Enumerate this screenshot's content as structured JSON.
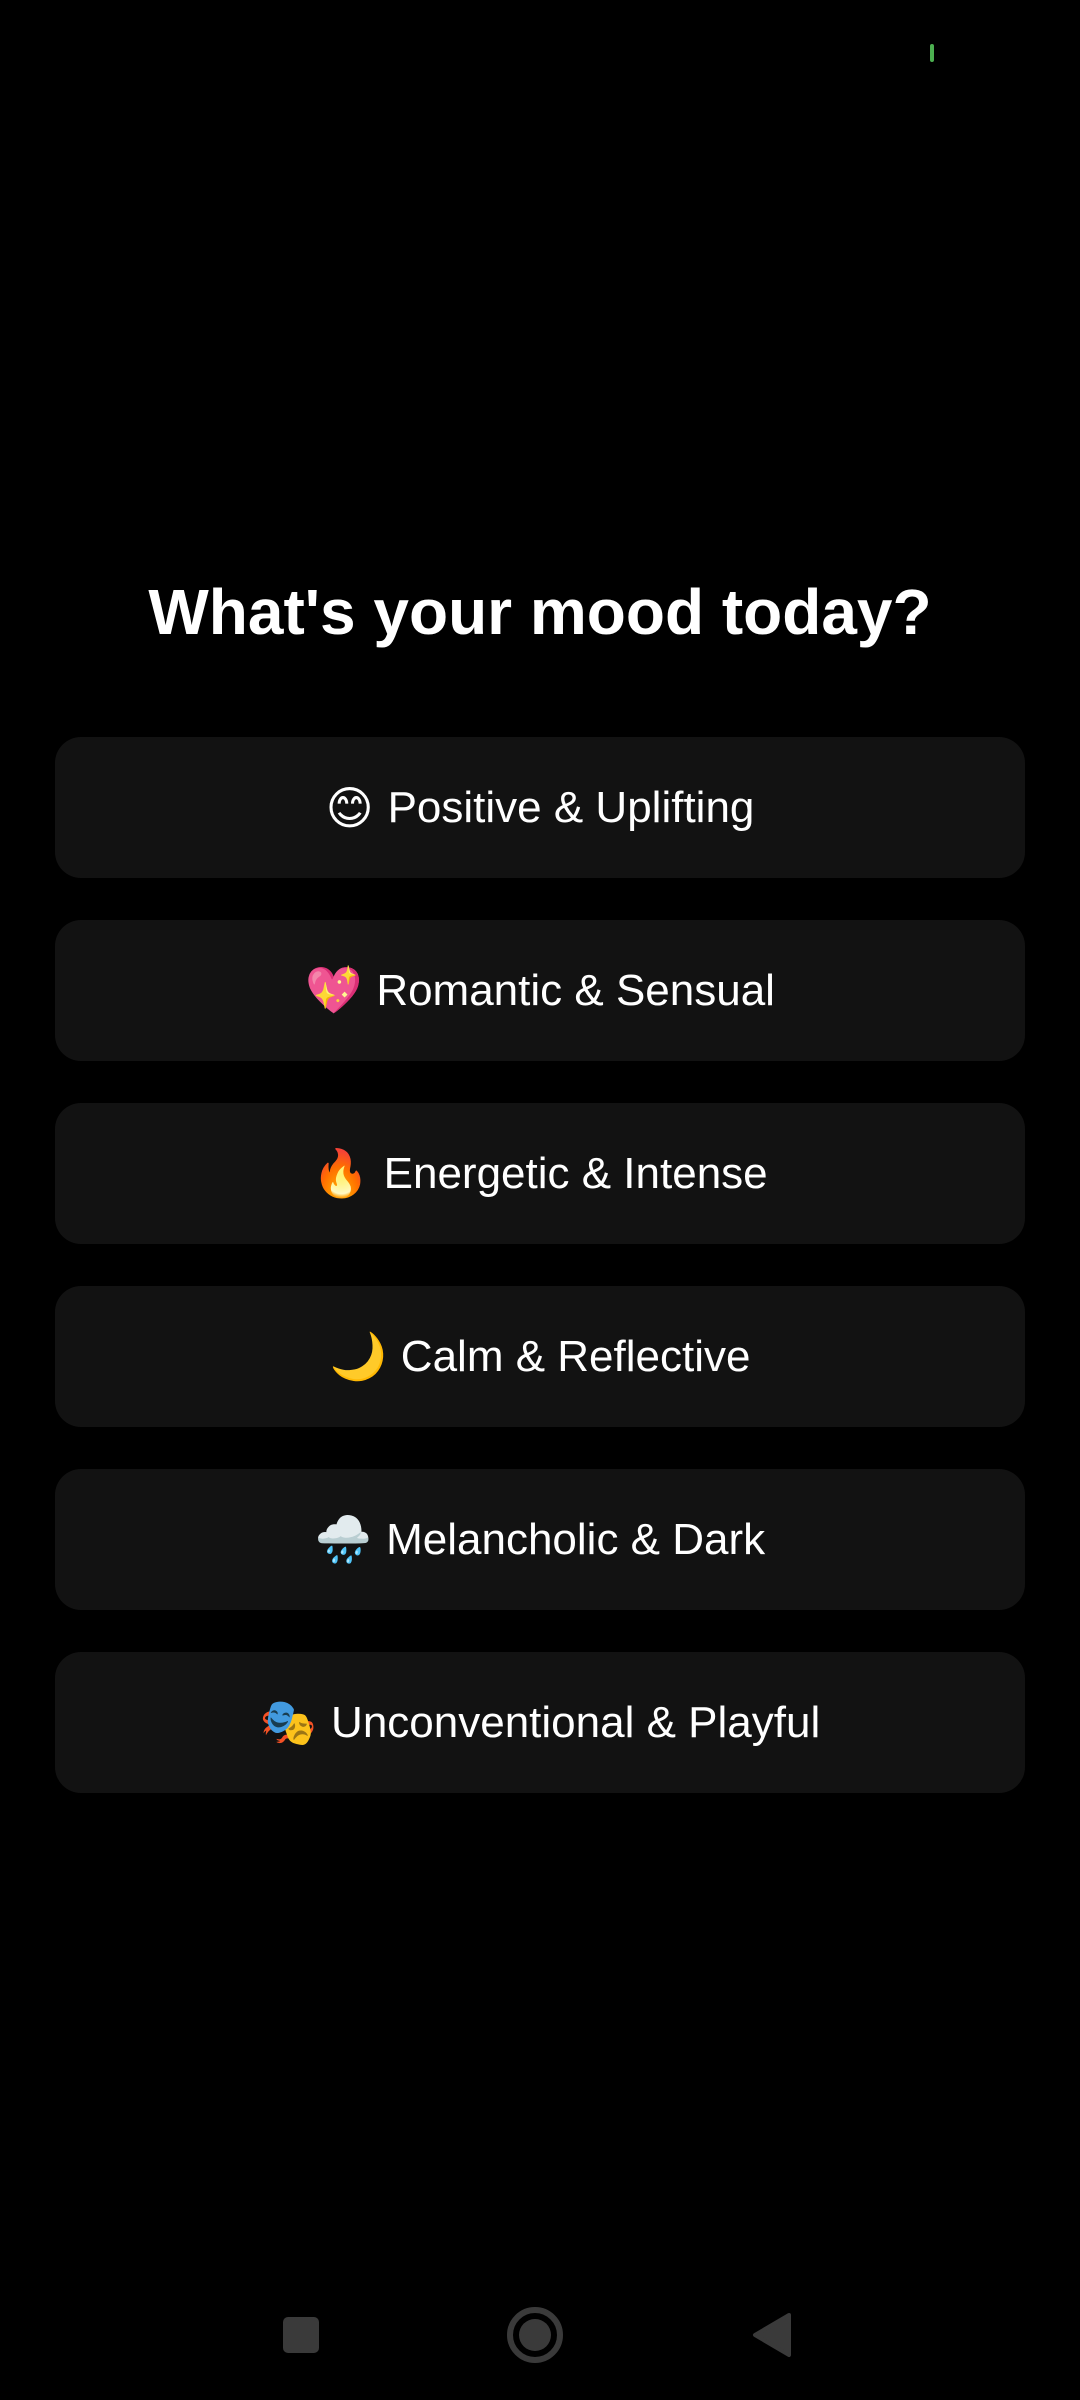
{
  "status_bar": {
    "indicator_color": "#4caf50"
  },
  "title": "What's your mood today?",
  "moods": [
    {
      "emoji": "😊",
      "label": "Positive & Uplifting"
    },
    {
      "emoji": "💖",
      "label": "Romantic & Sensual"
    },
    {
      "emoji": "🔥",
      "label": "Energetic & Intense"
    },
    {
      "emoji": "🌙",
      "label": "Calm & Reflective"
    },
    {
      "emoji": "🌧️",
      "label": "Melancholic & Dark"
    },
    {
      "emoji": "🎭",
      "label": "Unconventional & Playful"
    }
  ],
  "navigation": {
    "icons": [
      "recents-icon",
      "home-icon",
      "back-icon"
    ]
  }
}
